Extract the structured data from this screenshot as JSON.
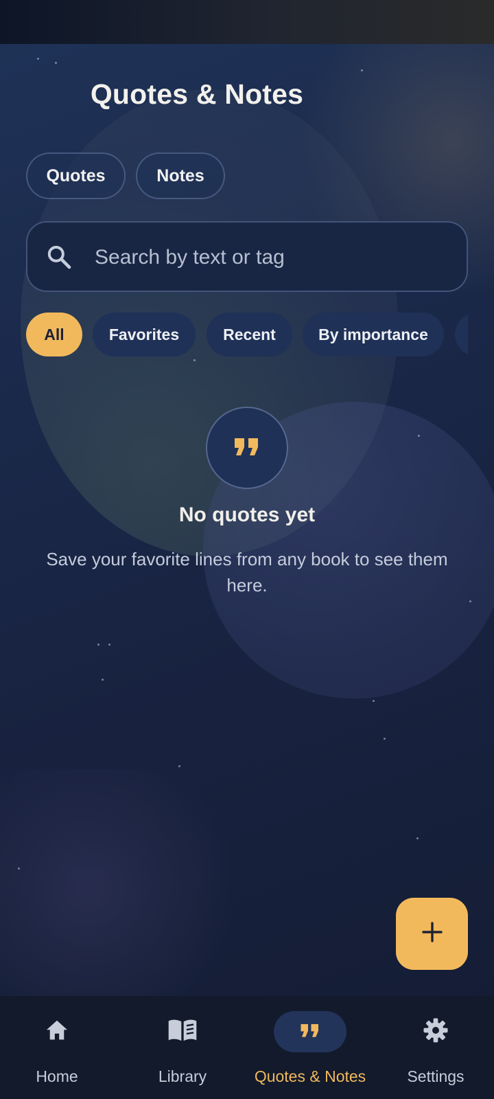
{
  "header": {
    "title": "Quotes & Notes"
  },
  "segments": [
    {
      "label": "Quotes"
    },
    {
      "label": "Notes"
    }
  ],
  "search": {
    "placeholder": "Search by text or tag",
    "value": "",
    "icon": "search-icon"
  },
  "filters": [
    {
      "label": "All",
      "active": true
    },
    {
      "label": "Favorites",
      "active": false
    },
    {
      "label": "Recent",
      "active": false
    },
    {
      "label": "By importance",
      "active": false
    }
  ],
  "empty_state": {
    "icon": "format-quote-icon",
    "title": "No quotes yet",
    "description": "Save your favorite lines from any book to see them here."
  },
  "fab": {
    "icon": "plus-icon"
  },
  "bottom_nav": {
    "items": [
      {
        "label": "Home",
        "icon": "home-icon",
        "active": false
      },
      {
        "label": "Library",
        "icon": "book-open-icon",
        "active": false
      },
      {
        "label": "Quotes & Notes",
        "icon": "format-quote-icon",
        "active": true
      },
      {
        "label": "Settings",
        "icon": "gear-icon",
        "active": false
      }
    ]
  },
  "colors": {
    "accent": "#f2b95c",
    "background": "#1a2849",
    "chip": "#1f3157",
    "navbar": "#121a2c"
  }
}
